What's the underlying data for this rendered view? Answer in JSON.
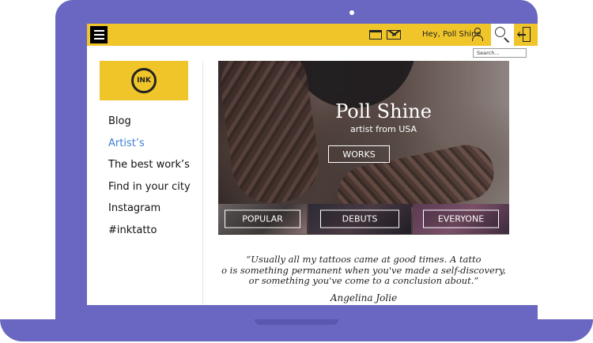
{
  "header": {
    "greeting": "Hey, Poll Shine",
    "search_placeholder": "Search..."
  },
  "sidebar": {
    "logo_text": "INK",
    "items": [
      {
        "label": "Blog"
      },
      {
        "label": "Artist’s",
        "active": true
      },
      {
        "label": "The best work’s"
      },
      {
        "label": "Find in your city"
      },
      {
        "label": "Instagram"
      },
      {
        "label": "#inktatto"
      }
    ]
  },
  "hero": {
    "title": "Poll Shine",
    "subtitle": "artist from USA",
    "button_label": "WORKS"
  },
  "categories": [
    {
      "label": "POPULAR"
    },
    {
      "label": "DEBUTS"
    },
    {
      "label": "EVERYONE"
    }
  ],
  "quote": {
    "line1": "“Usually all my tattoos came at good times. A tatto",
    "line2": "o is something permanent when you've made a self-discovery,",
    "line3": "or something you've come to a conclusion about.”",
    "author": "Angelina Jolie"
  },
  "colors": {
    "frame": "#6a67c2",
    "accent_yellow": "#f0c52a",
    "active_link": "#3f7fd0"
  }
}
